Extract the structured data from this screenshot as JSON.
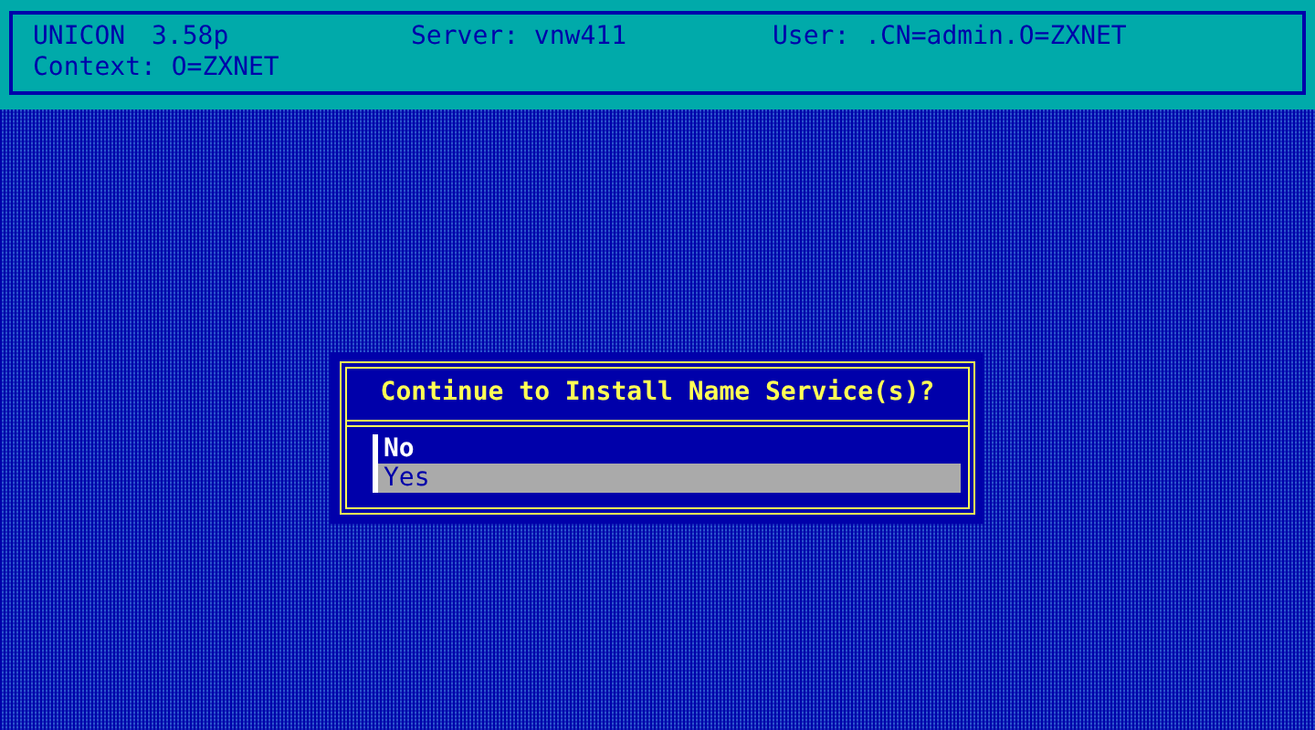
{
  "header": {
    "product": "UNICON",
    "version": "3.58p",
    "server": "Server: vnw411",
    "user": "User: .CN=admin.O=ZXNET",
    "context": "Context: O=ZXNET"
  },
  "dialog": {
    "title": "Continue to Install Name Service(s)?",
    "options": [
      {
        "label": "No",
        "selected": false
      },
      {
        "label": "Yes",
        "selected": true
      }
    ]
  }
}
